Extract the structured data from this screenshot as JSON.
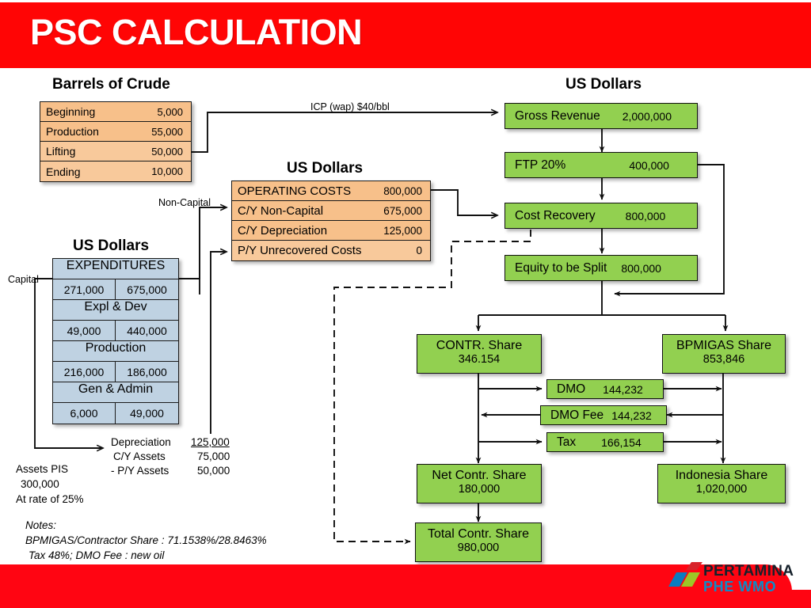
{
  "header": {
    "title": "PSC CALCULATION",
    "accent_color": "#FF0505"
  },
  "footer": {
    "brand_line1": "PERTAMINA",
    "brand_line2": "PHE WMO",
    "accent_color": "#FF0512",
    "brand_color_1": "#16212B",
    "brand_color_2": "#0C8CC8"
  },
  "sections": {
    "barrels_title": "Barrels of Crude",
    "opcost_title": "US Dollars",
    "expend_title": "US Dollars",
    "revenue_title": "US Dollars"
  },
  "barrels_of_crude": {
    "rows": [
      {
        "label": "Beginning",
        "value": "5,000"
      },
      {
        "label": "Production",
        "value": "55,000"
      },
      {
        "label": "Lifting",
        "value": "50,000"
      },
      {
        "label": "Ending",
        "value": "10,000"
      }
    ]
  },
  "operating_costs": {
    "rows": [
      {
        "label": "OPERATING COSTS",
        "value": "800,000"
      },
      {
        "label": "C/Y Non-Capital",
        "value": "675,000"
      },
      {
        "label": "C/Y Depreciation",
        "value": "125,000"
      },
      {
        "label": "P/Y Unrecovered Costs",
        "value": "0"
      }
    ]
  },
  "expenditures": {
    "header": "EXPENDITURES",
    "groups": [
      {
        "name": "",
        "capital": "271,000",
        "non_capital": "675,000"
      },
      {
        "name": "Expl & Dev",
        "capital": "49,000",
        "non_capital": "440,000"
      },
      {
        "name": "Production",
        "capital": "216,000",
        "non_capital": "186,000"
      },
      {
        "name": "Gen & Admin",
        "capital": "6,000",
        "non_capital": "49,000"
      }
    ]
  },
  "depreciation": {
    "rows": [
      {
        "label": "Depreciation",
        "value": "125,000"
      },
      {
        "label": "C/Y Assets",
        "value": "75,000"
      },
      {
        "label": "- P/Y Assets",
        "value": "50,000"
      }
    ]
  },
  "assets": {
    "line1": "Assets PIS",
    "line2": "300,000",
    "line3": "At  rate of 25%"
  },
  "notes": {
    "title": "Notes:",
    "line1": "BPMIGAS/Contractor Share : 71.1538%/28.8463%",
    "line2": "Tax 48%;  DMO Fee : new oil"
  },
  "labels": {
    "icp": "ICP (wap) $40/bbl",
    "non_capital": "Non-Capital",
    "capital": "Capital"
  },
  "flow_boxes": [
    {
      "id": "gross_revenue",
      "label": "Gross Revenue",
      "value": "2,000,000"
    },
    {
      "id": "ftp",
      "label": "FTP 20%",
      "value": "400,000"
    },
    {
      "id": "cost_recovery",
      "label": "Cost Recovery",
      "value": "800,000"
    },
    {
      "id": "equity_split",
      "label": "Equity to be Split",
      "value": "800,000"
    },
    {
      "id": "contr_share",
      "label": "CONTR. Share",
      "value": "346.154"
    },
    {
      "id": "bpmigas_share",
      "label": "BPMIGAS Share",
      "value": "853,846"
    },
    {
      "id": "dmo",
      "label": "DMO",
      "value": "144,232"
    },
    {
      "id": "dmo_fee",
      "label": "DMO Fee",
      "value": "144,232"
    },
    {
      "id": "tax",
      "label": "Tax",
      "value": "166,154"
    },
    {
      "id": "net_contr_share",
      "label": "Net Contr. Share",
      "value": "180,000"
    },
    {
      "id": "indonesia_share",
      "label": "Indonesia Share",
      "value": "1,020,000"
    },
    {
      "id": "total_contr_share",
      "label": "Total Contr. Share",
      "value": "980,000"
    }
  ],
  "colors": {
    "process_green": "#92D050",
    "table_orange": "#F7C08A",
    "table_blue": "#BFD2E2",
    "line": "#111111"
  }
}
